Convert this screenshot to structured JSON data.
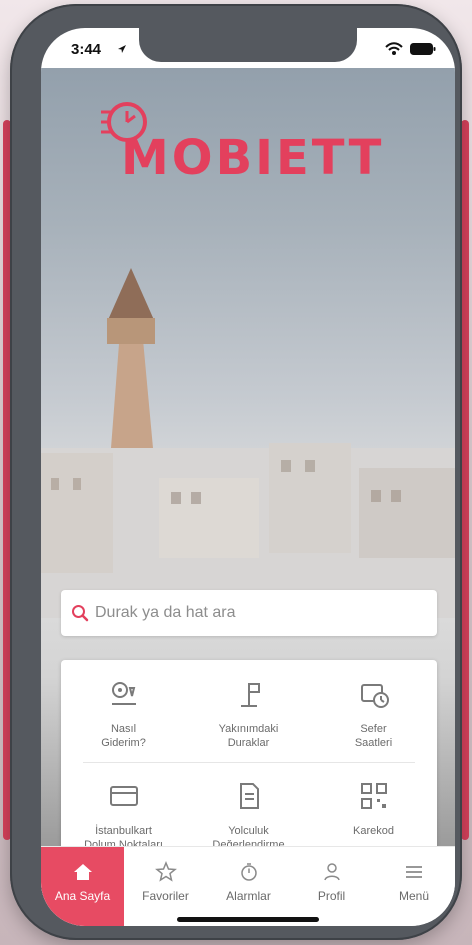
{
  "status": {
    "time": "3:44"
  },
  "logo": {
    "text": "MOBIETT"
  },
  "search": {
    "placeholder": "Durak ya da hat ara",
    "icon": "search-icon"
  },
  "quick_actions": {
    "items": [
      {
        "label": "Nasıl\nGiderim?",
        "icon": "route-pin-icon"
      },
      {
        "label": "Yakınımdaki\nDuraklar",
        "icon": "bus-stop-icon"
      },
      {
        "label": "Sefer\nSaatleri",
        "icon": "schedule-clock-icon"
      },
      {
        "label": "İstanbulkart\nDolum Noktaları",
        "icon": "card-topup-icon"
      },
      {
        "label": "Yolculuk\nDeğerlendirme",
        "icon": "rating-form-icon"
      },
      {
        "label": "Karekod",
        "icon": "qr-code-icon"
      }
    ]
  },
  "tabs": [
    {
      "label": "Ana Sayfa",
      "icon": "home-icon",
      "active": true
    },
    {
      "label": "Favoriler",
      "icon": "star-icon",
      "active": false
    },
    {
      "label": "Alarmlar",
      "icon": "stopwatch-icon",
      "active": false
    },
    {
      "label": "Profil",
      "icon": "user-icon",
      "active": false
    },
    {
      "label": "Menü",
      "icon": "menu-icon",
      "active": false
    }
  ],
  "colors": {
    "accent": "#e74b63",
    "logo": "#e3405d",
    "text_muted": "#6b6b6b"
  }
}
